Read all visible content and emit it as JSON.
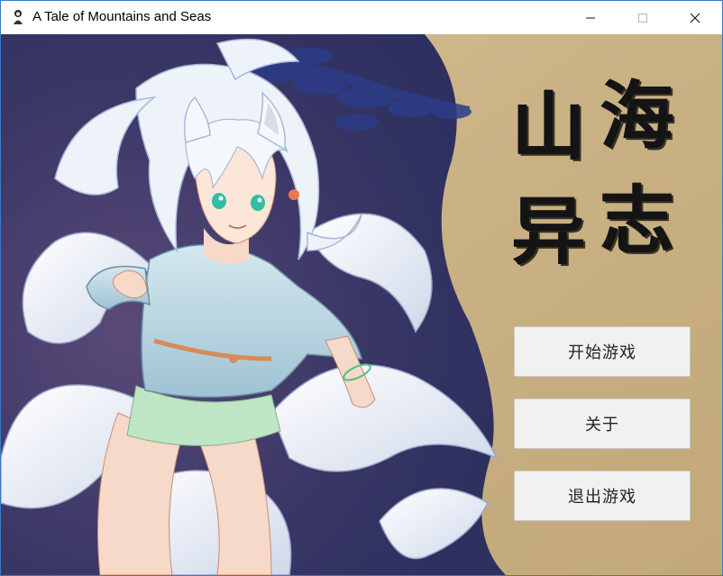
{
  "window": {
    "title": "A Tale of Mountains and Seas",
    "app_icon": "person-icon",
    "controls": [
      "minimize-icon",
      "maximize-icon",
      "close-icon"
    ]
  },
  "logo": {
    "chars": [
      "海",
      "山",
      "志",
      "异"
    ]
  },
  "menu": {
    "start_label": "开始游戏",
    "about_label": "关于",
    "exit_label": "退出游戏"
  },
  "colors": {
    "parchment": "#cdb589",
    "night_sky": "#3e3c6a",
    "button_bg": "#f1f1f1",
    "logo_ink": "#141414",
    "pine_blue": "#2c3c88"
  }
}
